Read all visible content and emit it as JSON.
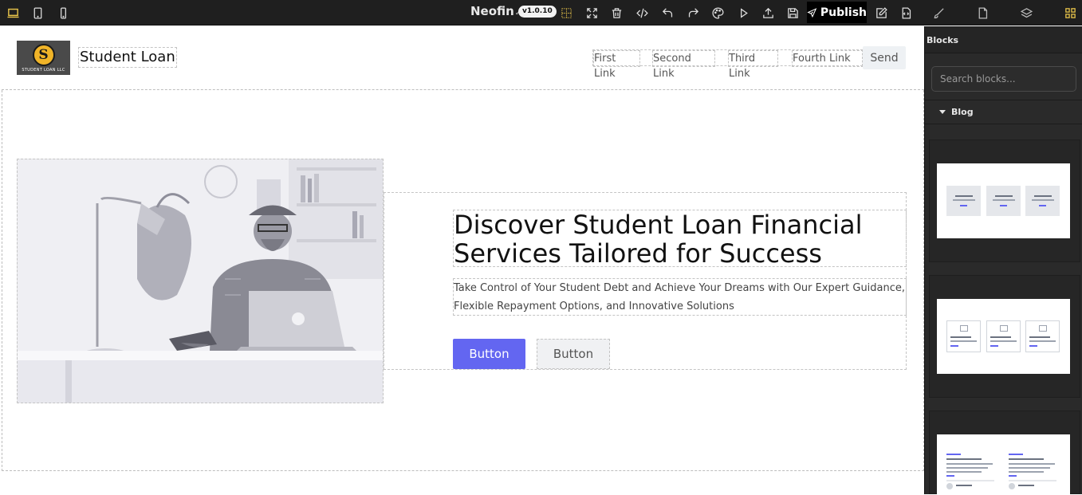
{
  "toolbar": {
    "brand": "Neofin",
    "version": "v1.0.10",
    "publish_label": "Publish"
  },
  "site": {
    "logo_text": "STUDENT LOAN LLC",
    "logo_letter": "S",
    "title": "Student Loan",
    "nav": [
      "First Link",
      "Second Link",
      "Third Link",
      "Fourth Link"
    ],
    "send_label": "Send"
  },
  "hero": {
    "title": "Discover Student Loan Financial Services Tailored for Success",
    "subtitle": "Take Control of Your Student Debt and Achieve Your Dreams with Our Expert Guidance, Flexible Repayment Options, and Innovative Solutions",
    "primary_button": "Button",
    "secondary_button": "Button"
  },
  "panel": {
    "title": "Blocks",
    "search_placeholder": "Search blocks...",
    "category": "Blog"
  },
  "colors": {
    "accent": "#6366f1",
    "toolbar_bg": "#1f1f1f",
    "panel_bg": "#2a2a2a",
    "active_icon": "#e8c44a"
  },
  "icons": {
    "device_desktop": "laptop-icon",
    "device_tablet": "tablet-icon",
    "device_mobile": "mobile-icon",
    "grid": "grid-icon",
    "fullscreen": "fullscreen-icon",
    "trash": "trash-icon",
    "code": "code-icon",
    "undo": "undo-icon",
    "redo": "redo-icon",
    "palette": "palette-icon",
    "preview": "play-icon",
    "export": "upload-icon",
    "save": "floppy-icon",
    "edit": "edit-icon",
    "import": "file-code-icon",
    "brush": "brush-icon",
    "page": "page-icon",
    "layers": "layers-icon",
    "blocks": "blocks-icon"
  }
}
